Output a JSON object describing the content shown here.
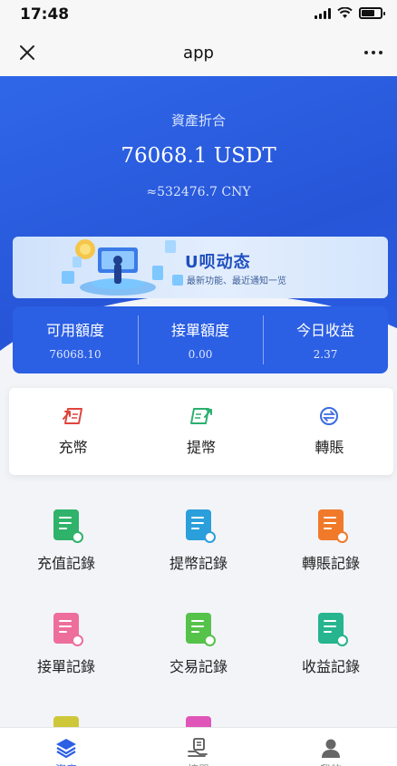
{
  "status_bar": {
    "time": "17:48"
  },
  "nav": {
    "title": "app"
  },
  "hero": {
    "label": "資產折合",
    "total": "76068.1 USDT",
    "cny": "≈532476.7 CNY"
  },
  "banner": {
    "title": "U呗动态",
    "subtitle": "最新功能、最近通知一览"
  },
  "stats": [
    {
      "label": "可用額度",
      "value": "76068.10"
    },
    {
      "label": "接單額度",
      "value": "0.00"
    },
    {
      "label": "今日收益",
      "value": "2.37"
    }
  ],
  "actions": [
    {
      "label": "充幣",
      "icon": "deposit-icon",
      "color": "#e0443e"
    },
    {
      "label": "提幣",
      "icon": "withdraw-icon",
      "color": "#2ab06f"
    },
    {
      "label": "轉賬",
      "icon": "transfer-icon",
      "color": "#3b6be0"
    }
  ],
  "records": [
    {
      "label": "充值記錄",
      "icon": "deposit-record-icon",
      "color": "#2fb36a"
    },
    {
      "label": "提幣記錄",
      "icon": "withdraw-record-icon",
      "color": "#2b9fdb"
    },
    {
      "label": "轉賬記錄",
      "icon": "transfer-record-icon",
      "color": "#f07a2a"
    },
    {
      "label": "接單記錄",
      "icon": "order-record-icon",
      "color": "#ee6e9b"
    },
    {
      "label": "交易記錄",
      "icon": "trade-record-icon",
      "color": "#55c24a"
    },
    {
      "label": "收益記錄",
      "icon": "income-record-icon",
      "color": "#26b58e"
    },
    {
      "label": "",
      "icon": "record-icon",
      "color": "#cfc73a"
    },
    {
      "label": "",
      "icon": "record-icon",
      "color": "#e055b8"
    }
  ],
  "tabs": [
    {
      "label": "資產",
      "icon": "layers-icon"
    },
    {
      "label": "接單",
      "icon": "hand-icon"
    },
    {
      "label": "我的",
      "icon": "user-icon"
    }
  ],
  "colors": {
    "primary": "#2b5fe4",
    "background": "#f3f4f8"
  }
}
